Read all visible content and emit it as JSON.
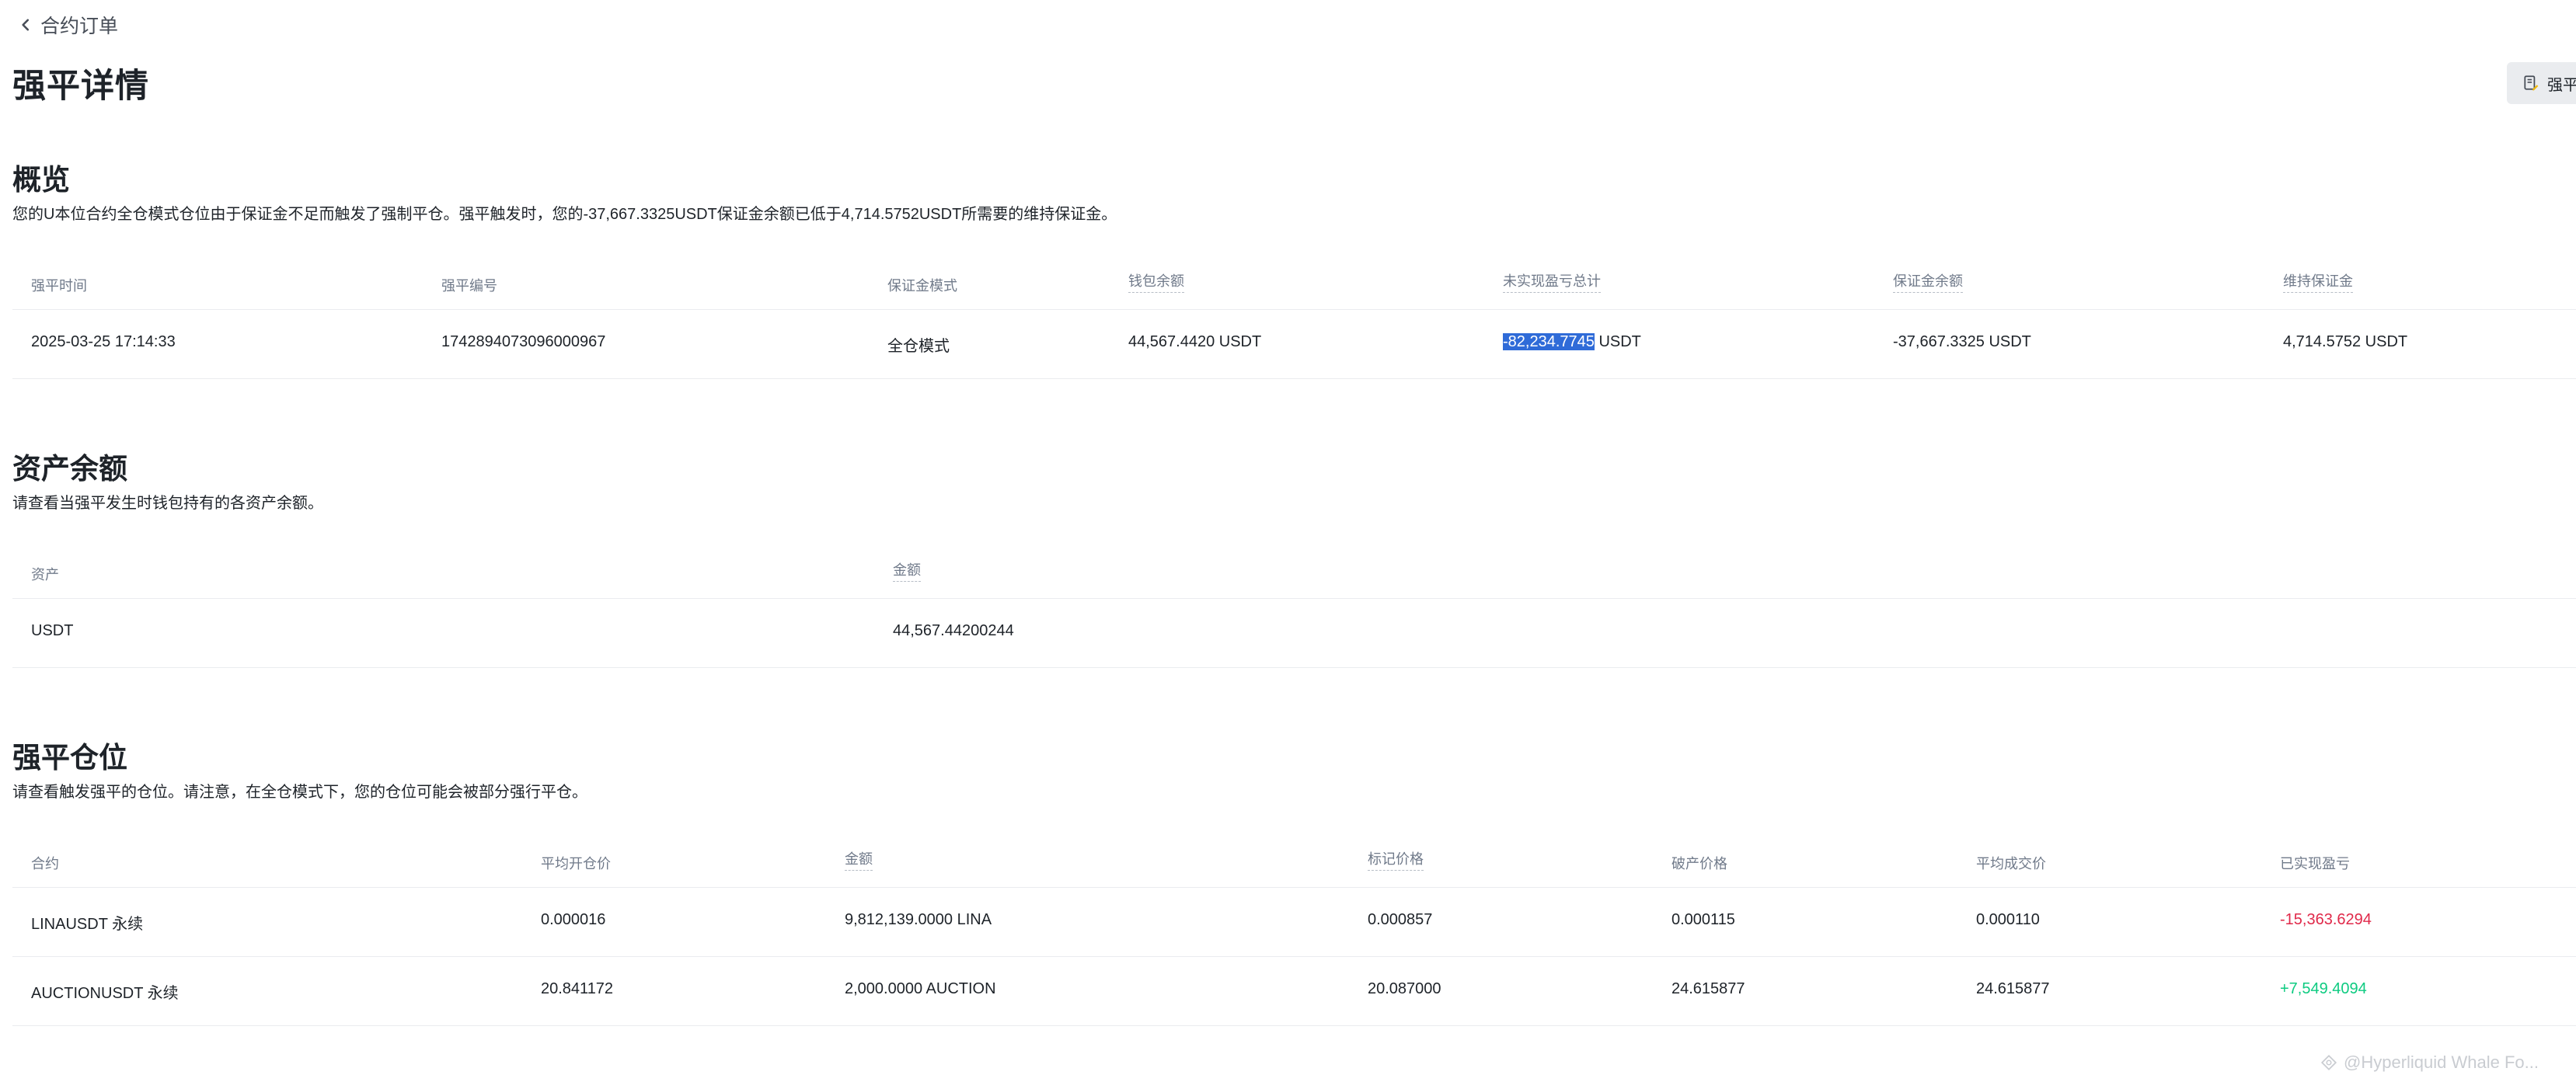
{
  "nav": {
    "back_label": "合约订单",
    "page_title": "强平详情",
    "top_right_button_label": "强平"
  },
  "overview": {
    "title": "概览",
    "description": "您的U本位合约全仓模式仓位由于保证金不足而触发了强制平仓。强平触发时，您的-37,667.3325USDT保证金余额已低于4,714.5752USDT所需要的维持保证金。",
    "columns": [
      "强平时间",
      "强平编号",
      "保证金模式",
      "钱包余额",
      "未实现盈亏总计",
      "保证金余额",
      "维持保证金"
    ],
    "row": {
      "time": "2025-03-25 17:14:33",
      "id": "1742894073096000967",
      "margin_mode": "全仓模式",
      "wallet_balance": "44,567.4420 USDT",
      "unrealized_pnl_value": "-82,234.7745",
      "unrealized_pnl_unit": " USDT",
      "margin_balance": "-37,667.3325 USDT",
      "maintenance_margin": "4,714.5752 USDT"
    }
  },
  "assets": {
    "title": "资产余额",
    "description": "请查看当强平发生时钱包持有的各资产余额。",
    "columns": [
      "资产",
      "金额"
    ],
    "rows": [
      {
        "asset": "USDT",
        "amount": "44,567.44200244"
      }
    ]
  },
  "positions": {
    "title": "强平仓位",
    "description": "请查看触发强平的仓位。请注意，在全仓模式下，您的仓位可能会被部分强行平仓。",
    "columns": [
      "合约",
      "平均开仓价",
      "金额",
      "标记价格",
      "破产价格",
      "平均成交价",
      "已实现盈亏"
    ],
    "rows": [
      {
        "contract": "LINAUSDT 永续",
        "avg_open": "0.000016",
        "amount": "9,812,139.0000 LINA",
        "mark_price": "0.000857",
        "bankruptcy_price": "0.000115",
        "avg_fill": "0.000110",
        "realized_pnl": "-15,363.6294"
      },
      {
        "contract": "AUCTIONUSDT 永续",
        "avg_open": "20.841172",
        "amount": "2,000.0000 AUCTION",
        "mark_price": "20.087000",
        "bankruptcy_price": "24.615877",
        "avg_fill": "24.615877",
        "realized_pnl": "+7,549.4094"
      }
    ]
  },
  "watermark": "@Hyperliquid Whale Fo...",
  "colors": {
    "negative": "#e0294a",
    "positive": "#0ecb81",
    "selection": "#2f6bd8"
  }
}
